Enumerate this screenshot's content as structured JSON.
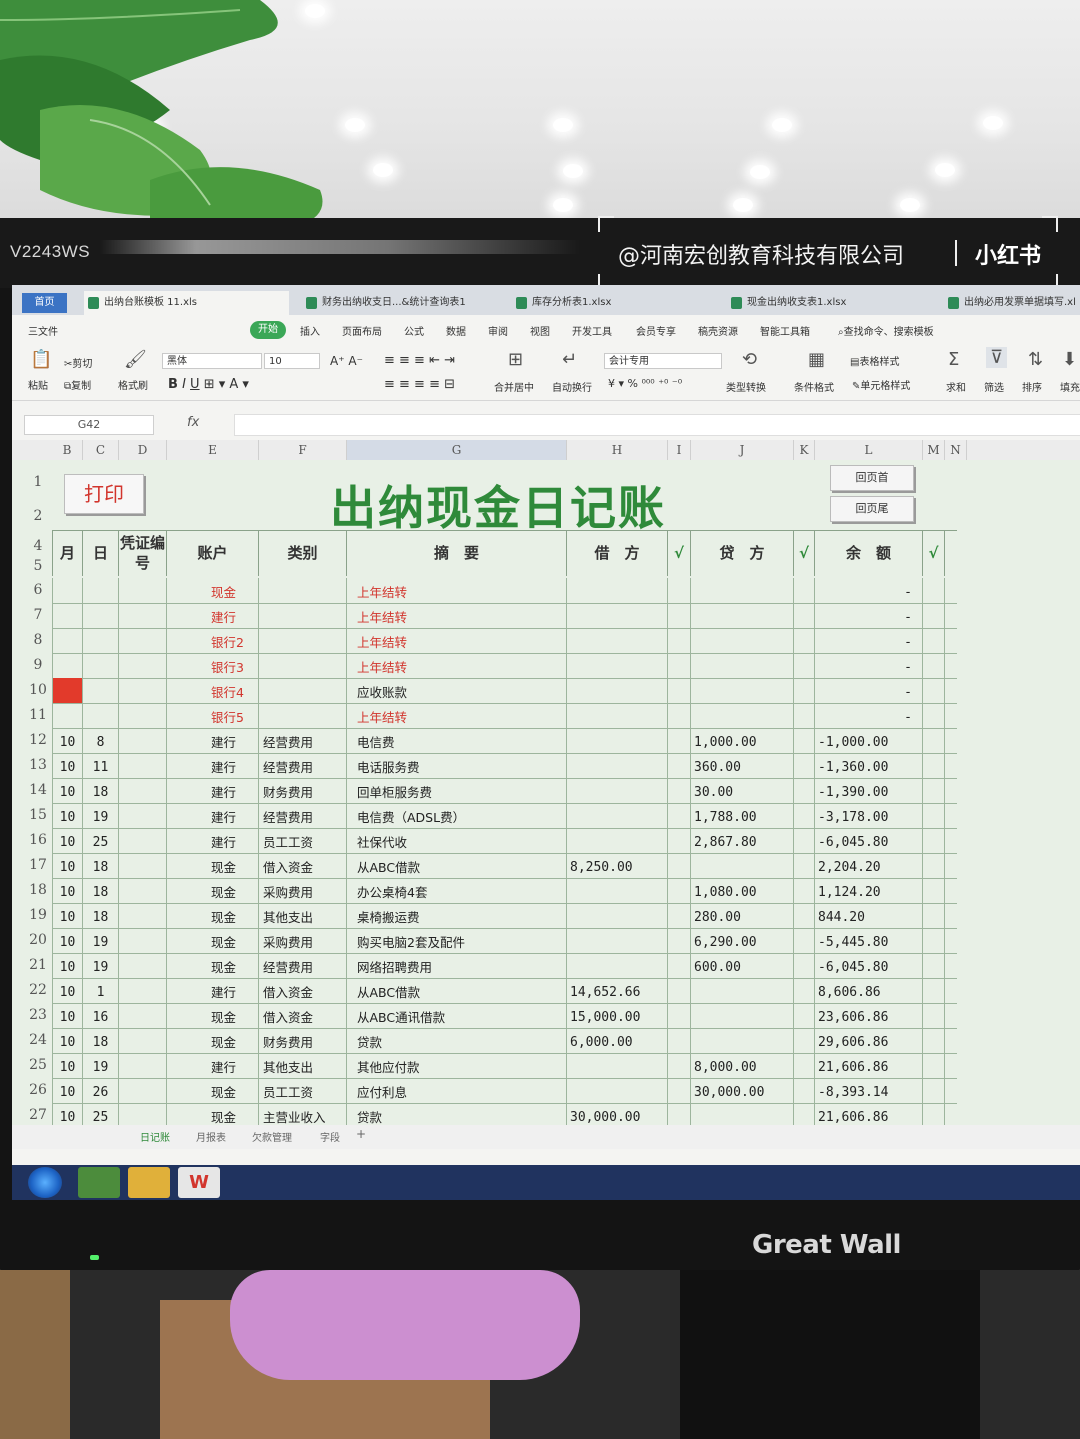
{
  "monitor": {
    "model": "V2243WS",
    "brand": "Great Wall"
  },
  "watermark": {
    "text": "@河南宏创教育科技有限公司",
    "logo": "小红书"
  },
  "app": {
    "home_tab": "首页",
    "doc_tabs": [
      "出纳台账模板 11.xls",
      "财务出纳收支日...&统计查询表1",
      "库存分析表1.xlsx",
      "现金出纳收支表1.xlsx",
      "出纳必用发票单据填写.xl"
    ],
    "menu": {
      "file": "三文件",
      "start": "开始",
      "items": [
        "插入",
        "页面布局",
        "公式",
        "数据",
        "审阅",
        "视图",
        "开发工具",
        "会员专享",
        "稿壳资源",
        "智能工具箱"
      ],
      "search": "查找命令、搜索模板"
    },
    "ribbon": {
      "paste": "粘贴",
      "cut": "剪切",
      "copy": "复制",
      "format_painter": "格式刷",
      "font": "黑体",
      "font_size": "10",
      "merge": "合并居中",
      "wrap": "自动换行",
      "number_format": "会计专用",
      "type_convert": "类型转换",
      "cond_format": "条件格式",
      "table_style": "表格样式",
      "cell_style": "单元格样式",
      "sum": "求和",
      "filter": "筛选",
      "sort": "排序",
      "fill": "填充"
    },
    "name_box": "G42",
    "fx": "fx",
    "columns": [
      "B",
      "C",
      "D",
      "E",
      "F",
      "G",
      "H",
      "I",
      "J",
      "K",
      "L",
      "M",
      "N"
    ],
    "selected_column": "G"
  },
  "sheet": {
    "title": "出纳现金日记账",
    "print_button": "打印",
    "nav_top": "回页首",
    "nav_bottom": "回页尾",
    "headers": {
      "month": "月",
      "day": "日",
      "voucher": "凭证编号",
      "account": "账户",
      "category": "类别",
      "summary": "摘　要",
      "debit": "借　方",
      "check1": "√",
      "credit": "贷　方",
      "check2": "√",
      "balance": "余　额",
      "check3": "√"
    },
    "rows": [
      {
        "n": "6",
        "m": "",
        "d": "",
        "acc": "现金",
        "cat": "",
        "sum": "上年结转",
        "dr": "",
        "cr": "",
        "bal": "-",
        "red": true
      },
      {
        "n": "7",
        "m": "",
        "d": "",
        "acc": "建行",
        "cat": "",
        "sum": "上年结转",
        "dr": "",
        "cr": "",
        "bal": "-",
        "red": true
      },
      {
        "n": "8",
        "m": "",
        "d": "",
        "acc": "银行2",
        "cat": "",
        "sum": "上年结转",
        "dr": "",
        "cr": "",
        "bal": "-",
        "red": true
      },
      {
        "n": "9",
        "m": "",
        "d": "",
        "acc": "银行3",
        "cat": "",
        "sum": "上年结转",
        "dr": "",
        "cr": "",
        "bal": "-",
        "red": true
      },
      {
        "n": "10",
        "m": "",
        "d": "",
        "acc": "银行4",
        "cat": "",
        "sum": "应收账款",
        "dr": "",
        "cr": "",
        "bal": "-",
        "red": true,
        "sumblack": true,
        "flag": true
      },
      {
        "n": "11",
        "m": "",
        "d": "",
        "acc": "银行5",
        "cat": "",
        "sum": "上年结转",
        "dr": "",
        "cr": "",
        "bal": "-",
        "red": true
      },
      {
        "n": "12",
        "m": "10",
        "d": "8",
        "acc": "建行",
        "cat": "经营费用",
        "sum": "电信费",
        "dr": "",
        "cr": "1,000.00",
        "bal": "-1,000.00"
      },
      {
        "n": "13",
        "m": "10",
        "d": "11",
        "acc": "建行",
        "cat": "经营费用",
        "sum": "电话服务费",
        "dr": "",
        "cr": "360.00",
        "bal": "-1,360.00"
      },
      {
        "n": "14",
        "m": "10",
        "d": "18",
        "acc": "建行",
        "cat": "财务费用",
        "sum": "回单柜服务费",
        "dr": "",
        "cr": "30.00",
        "bal": "-1,390.00"
      },
      {
        "n": "15",
        "m": "10",
        "d": "19",
        "acc": "建行",
        "cat": "经营费用",
        "sum": "电信费（ADSL费）",
        "dr": "",
        "cr": "1,788.00",
        "bal": "-3,178.00"
      },
      {
        "n": "16",
        "m": "10",
        "d": "25",
        "acc": "建行",
        "cat": "员工工资",
        "sum": "社保代收",
        "dr": "",
        "cr": "2,867.80",
        "bal": "-6,045.80"
      },
      {
        "n": "17",
        "m": "10",
        "d": "18",
        "acc": "现金",
        "cat": "借入资金",
        "sum": "从ABC借款",
        "dr": "8,250.00",
        "cr": "",
        "bal": "2,204.20"
      },
      {
        "n": "18",
        "m": "10",
        "d": "18",
        "acc": "现金",
        "cat": "采购费用",
        "sum": "办公桌椅4套",
        "dr": "",
        "cr": "1,080.00",
        "bal": "1,124.20"
      },
      {
        "n": "19",
        "m": "10",
        "d": "18",
        "acc": "现金",
        "cat": "其他支出",
        "sum": "桌椅搬运费",
        "dr": "",
        "cr": "280.00",
        "bal": "844.20"
      },
      {
        "n": "20",
        "m": "10",
        "d": "19",
        "acc": "现金",
        "cat": "采购费用",
        "sum": "购买电脑2套及配件",
        "dr": "",
        "cr": "6,290.00",
        "bal": "-5,445.80"
      },
      {
        "n": "21",
        "m": "10",
        "d": "19",
        "acc": "现金",
        "cat": "经营费用",
        "sum": "网络招聘费用",
        "dr": "",
        "cr": "600.00",
        "bal": "-6,045.80"
      },
      {
        "n": "22",
        "m": "10",
        "d": "1",
        "acc": "建行",
        "cat": "借入资金",
        "sum": "从ABC借款",
        "dr": "14,652.66",
        "cr": "",
        "bal": "8,606.86"
      },
      {
        "n": "23",
        "m": "10",
        "d": "16",
        "acc": "现金",
        "cat": "借入资金",
        "sum": "从ABC通讯借款",
        "dr": "15,000.00",
        "cr": "",
        "bal": "23,606.86"
      },
      {
        "n": "24",
        "m": "10",
        "d": "18",
        "acc": "现金",
        "cat": "财务费用",
        "sum": "贷款",
        "dr": "6,000.00",
        "cr": "",
        "bal": "29,606.86"
      },
      {
        "n": "25",
        "m": "10",
        "d": "19",
        "acc": "建行",
        "cat": "其他支出",
        "sum": "其他应付款",
        "dr": "",
        "cr": "8,000.00",
        "bal": "21,606.86"
      },
      {
        "n": "26",
        "m": "10",
        "d": "26",
        "acc": "现金",
        "cat": "员工工资",
        "sum": "应付利息",
        "dr": "",
        "cr": "30,000.00",
        "bal": "-8,393.14"
      },
      {
        "n": "27",
        "m": "10",
        "d": "25",
        "acc": "现金",
        "cat": "主营业收入",
        "sum": "贷款",
        "dr": "30,000.00",
        "cr": "",
        "bal": "21,606.86"
      }
    ],
    "sheet_tabs": [
      "日记账",
      "月报表",
      "欠款管理",
      "字段"
    ],
    "add_sheet": "+"
  }
}
